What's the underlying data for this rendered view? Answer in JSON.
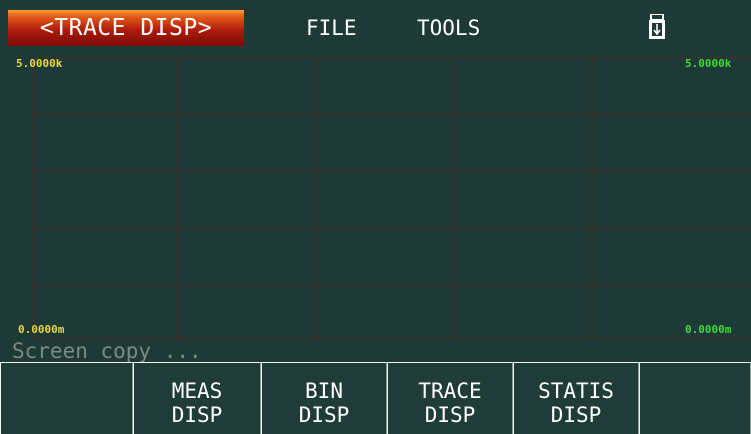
{
  "header": {
    "active_tab": "<TRACE DISP>",
    "menu_file": "FILE",
    "menu_tools": "TOOLS",
    "usb_icon": "usb-drive-icon"
  },
  "plot": {
    "y_max_left": "5.0000k",
    "y_min_left": "0.0000m",
    "y_max_right": "5.0000k",
    "y_min_right": "0.0000m",
    "grid_color": "#4d2a24",
    "left_label_color": "#e6d640",
    "right_label_color": "#3fd93a"
  },
  "status": {
    "message": "Screen copy ..."
  },
  "softkeys": [
    {
      "line1": "",
      "line2": ""
    },
    {
      "line1": "MEAS",
      "line2": "DISP"
    },
    {
      "line1": "BIN",
      "line2": "DISP"
    },
    {
      "line1": "TRACE",
      "line2": "DISP"
    },
    {
      "line1": "STATIS",
      "line2": "DISP"
    },
    {
      "line1": "",
      "line2": ""
    }
  ],
  "colors": {
    "background": "#1d3a36",
    "tab_gradient_top": "#ff9d3a",
    "tab_gradient_bottom": "#7a0a05"
  }
}
